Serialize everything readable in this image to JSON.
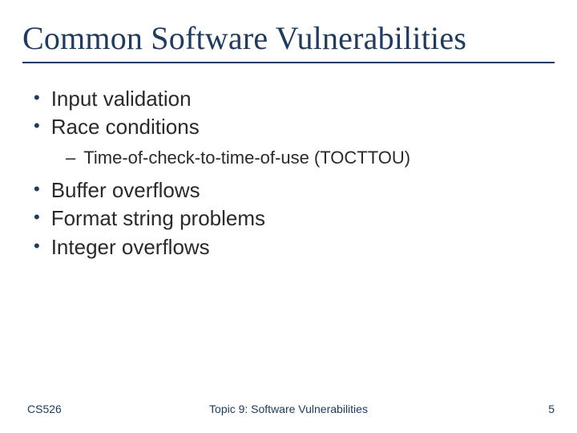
{
  "title": "Common Software Vulnerabilities",
  "bullets": [
    {
      "level": 1,
      "text": "Input validation"
    },
    {
      "level": 1,
      "text": "Race conditions"
    },
    {
      "level": 2,
      "text": "Time-of-check-to-time-of-use (TOCTTOU)"
    },
    {
      "level": 1,
      "text": "Buffer overflows"
    },
    {
      "level": 1,
      "text": "Format string problems"
    },
    {
      "level": 1,
      "text": "Integer overflows"
    }
  ],
  "footer": {
    "left": "CS526",
    "center": "Topic 9: Software Vulnerabilities",
    "right": "5"
  }
}
